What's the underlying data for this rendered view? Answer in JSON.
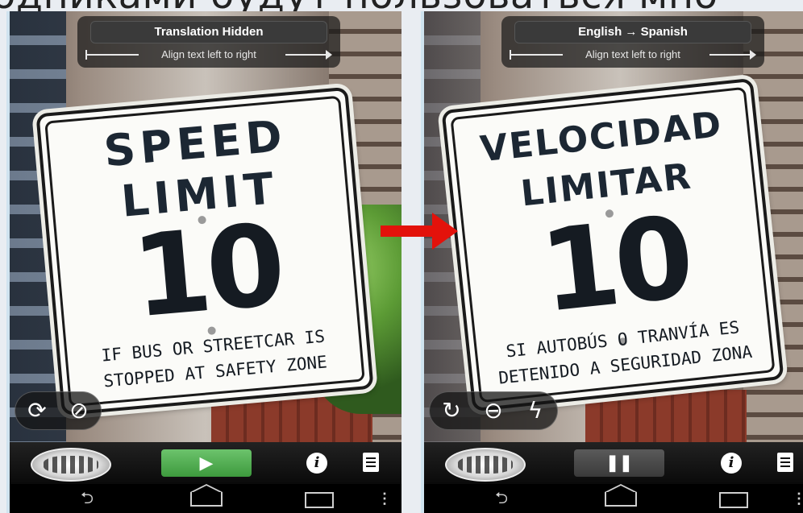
{
  "background_caption": "одниками будут пользоваться мно",
  "left_phone": {
    "mode_label": "Translation Hidden",
    "align_hint": "Align text left to right",
    "sign": {
      "line1": "SPEED",
      "line2": "LIMIT",
      "number": "10",
      "bottom1": "IF BUS OR STREETCAR IS",
      "bottom2": "STOPPED AT SAFETY ZONE"
    },
    "controls": {
      "rotate_lock_icon": "rotate-lock-icon",
      "hide_icon": "eye-slash-icon"
    },
    "bottom": {
      "action": "play"
    }
  },
  "right_phone": {
    "mode_label": "English → Spanish",
    "align_hint": "Align text left to right",
    "sign": {
      "line1": "VELOCIDAD",
      "line2": "LIMITAR",
      "number": "10",
      "bottom1": "SI AUTOBÚS O TRANVÍA ES",
      "bottom2": "DETENIDO A SEGURIDAD ZONA"
    },
    "controls": {
      "refresh_icon": "refresh-icon",
      "zoom_icon": "zoom-out-icon",
      "flash_icon": "flash-icon"
    },
    "bottom": {
      "action": "pause"
    }
  },
  "glyphs": {
    "play": "▶",
    "pause": "❚❚",
    "info": "i",
    "rotate_lock": "⟳",
    "hide": "⊘",
    "refresh": "↻",
    "zoom": "⊖",
    "flash": "ϟ",
    "back": "⮌",
    "menu": "⋮"
  },
  "colors": {
    "play_green": "#4caf50",
    "arrow_red": "#e3120b",
    "overlay_dark": "#191919"
  }
}
